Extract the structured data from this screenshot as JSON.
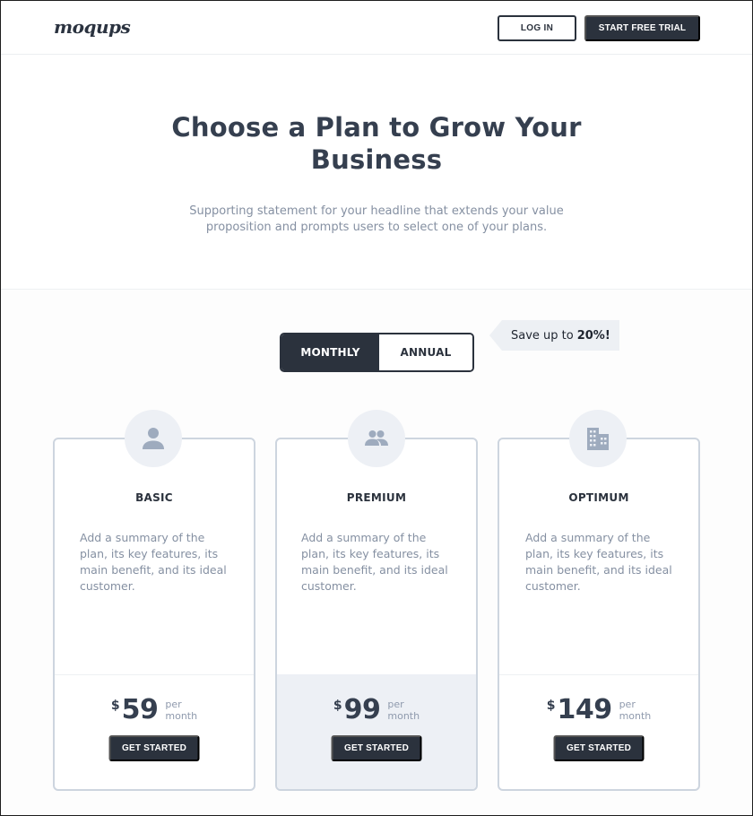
{
  "header": {
    "logo": "moqups",
    "login_label": "LOG IN",
    "trial_label": "START FREE TRIAL"
  },
  "hero": {
    "title": "Choose a Plan to Grow Your Business",
    "subtitle": "Supporting statement for your headline that extends your value proposition and prompts users to select one of your plans."
  },
  "billing_toggle": {
    "options": [
      {
        "label": "MONTHLY",
        "selected": true
      },
      {
        "label": "ANNUAL",
        "selected": false
      }
    ]
  },
  "savings_badge": {
    "prefix": "Save up to",
    "highlight": "20%!"
  },
  "colors": {
    "primary_dark": "#2b323d",
    "card_border": "#cdd5df",
    "icon_bg": "#edf0f5",
    "icon_fg": "#9eabbe",
    "muted_text": "#8590a2"
  },
  "plans": [
    {
      "icon": "user-icon",
      "name": "BASIC",
      "summary": "Add a summary of the plan, its key features, its main benefit, and its ideal customer.",
      "currency": "$",
      "price": "59",
      "period": "per month",
      "period_line1": "per",
      "period_line2": "month",
      "cta": "GET STARTED",
      "featured": false
    },
    {
      "icon": "users-icon",
      "name": "PREMIUM",
      "summary": "Add a summary of the plan, its key features, its main benefit, and its ideal customer.",
      "currency": "$",
      "price": "99",
      "period": "per month",
      "period_line1": "per",
      "period_line2": "month",
      "cta": "GET STARTED",
      "featured": true
    },
    {
      "icon": "building-icon",
      "name": "OPTIMUM",
      "summary": "Add a summary of the plan, its key features, its main benefit, and its ideal customer.",
      "currency": "$",
      "price": "149",
      "period": "per month",
      "period_line1": "per",
      "period_line2": "month",
      "cta": "GET STARTED",
      "featured": false
    }
  ]
}
